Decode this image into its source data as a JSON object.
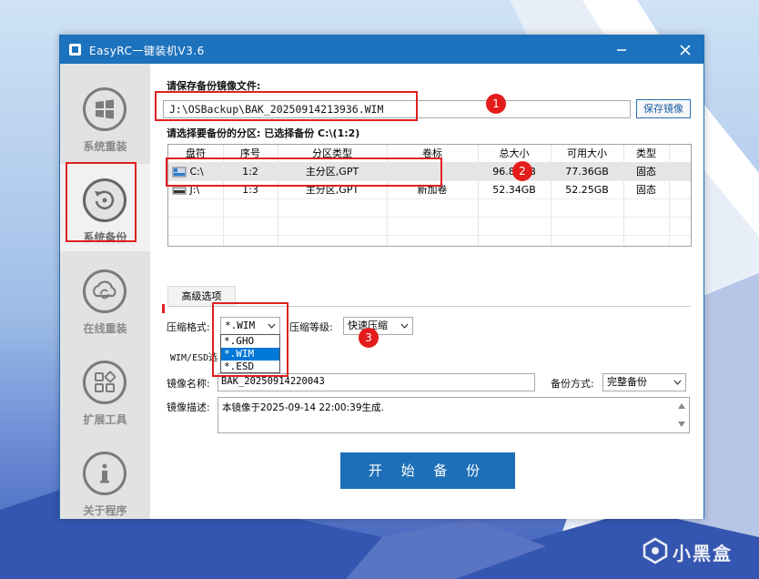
{
  "window": {
    "title": "EasyRC一键装机V3.6"
  },
  "sidebar": {
    "items": [
      {
        "label": "系统重装",
        "icon": "windows-icon"
      },
      {
        "label": "系统备份",
        "icon": "backup-icon"
      },
      {
        "label": "在线重装",
        "icon": "cloud-sync-icon"
      },
      {
        "label": "扩展工具",
        "icon": "tools-icon"
      },
      {
        "label": "关于程序",
        "icon": "info-icon"
      }
    ]
  },
  "save": {
    "label": "请保存备份镜像文件:",
    "path": "J:\\OSBackup\\BAK_20250914213936.WIM",
    "button": "保存镜像"
  },
  "partition": {
    "label": "请选择要备份的分区: 已选择备份 C:\\(1:2)",
    "columns": [
      "盘符",
      "序号",
      "分区类型",
      "卷标",
      "总大小",
      "可用大小",
      "类型"
    ],
    "rows": [
      {
        "drive": "C:\\",
        "index": "1:2",
        "ptype": "主分区,GPT",
        "volume": "",
        "total": "96.86GB",
        "free": "77.36GB",
        "kind": "固态"
      },
      {
        "drive": "J:\\",
        "index": "1:3",
        "ptype": "主分区,GPT",
        "volume": "新加卷",
        "total": "52.34GB",
        "free": "52.25GB",
        "kind": "固态"
      }
    ]
  },
  "advanced": {
    "tab": "高级选项",
    "format_label": "压缩格式:",
    "format_value": "*.WIM",
    "format_options": [
      "*.GHO",
      "*.WIM",
      "*.ESD"
    ],
    "level_label": "压缩等级:",
    "level_value": "快速压缩",
    "wim_esd_label": "WIM/ESD选",
    "name_label": "镜像名称:",
    "name_value": "BAK_20250914220043",
    "mode_label": "备份方式:",
    "mode_value": "完整备份",
    "desc_label": "镜像描述:",
    "desc_value": "本镜像于2025-09-14 22:00:39生成."
  },
  "start_button": "开 始 备 份",
  "annotations": [
    "1",
    "2",
    "3"
  ],
  "watermark": "小黑盒"
}
